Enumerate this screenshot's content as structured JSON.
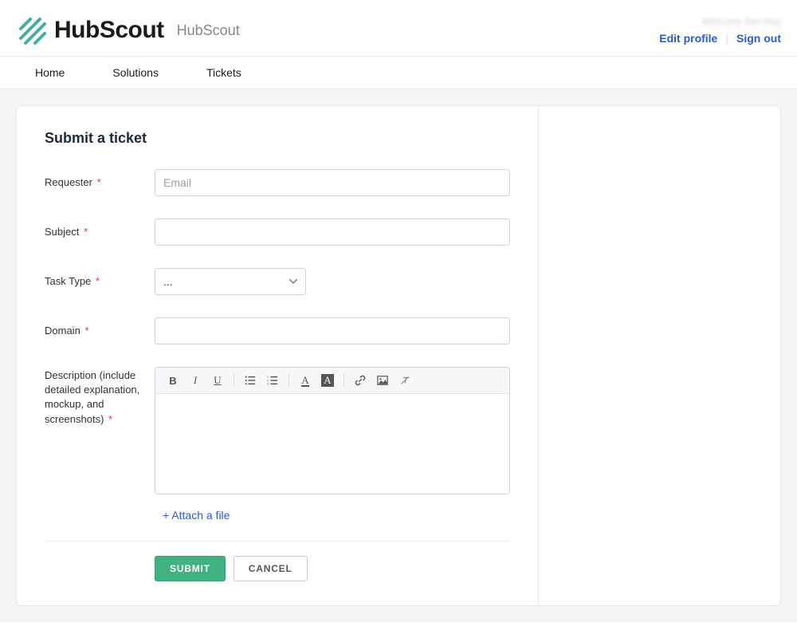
{
  "header": {
    "brand_name": "HubScout",
    "brand_subtitle": "HubScout",
    "welcome_text": "Welcome Ben Ray",
    "edit_profile": "Edit profile",
    "sign_out": "Sign out"
  },
  "nav": {
    "items": [
      {
        "label": "Home"
      },
      {
        "label": "Solutions"
      },
      {
        "label": "Tickets"
      }
    ]
  },
  "form": {
    "title": "Submit a ticket",
    "requester": {
      "label": "Requester",
      "placeholder": "Email",
      "value": ""
    },
    "subject": {
      "label": "Subject",
      "value": ""
    },
    "task_type": {
      "label": "Task Type",
      "selected": "..."
    },
    "domain": {
      "label": "Domain",
      "value": ""
    },
    "description": {
      "label": "Description (include detailed explanation, mockup, and screenshots)",
      "value": ""
    },
    "attach_label": "+ Attach a file",
    "submit_label": "SUBMIT",
    "cancel_label": "CANCEL"
  },
  "editor_icons": {
    "bold": "B",
    "italic": "I",
    "underline": "U",
    "ul": "ul",
    "ol": "ol",
    "text_color": "A",
    "bg_color": "A",
    "link": "link",
    "image": "img",
    "clear": "clear"
  }
}
